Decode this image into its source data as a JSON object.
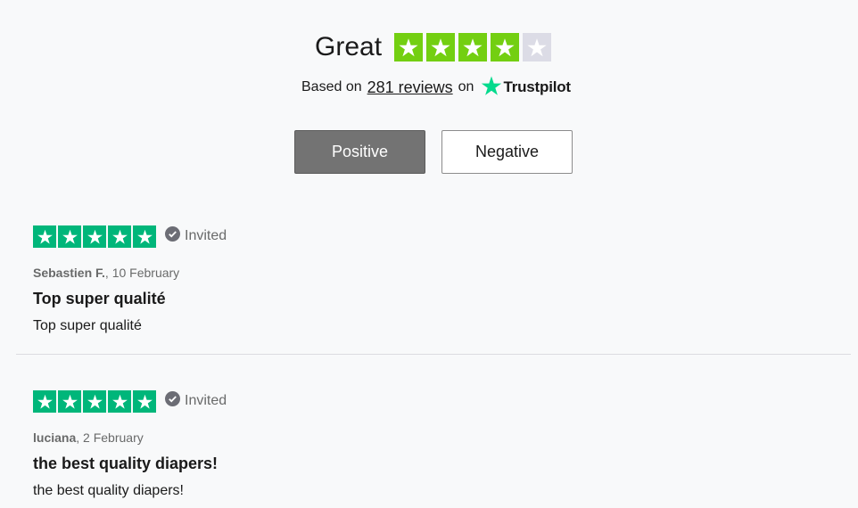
{
  "summary": {
    "rating_word": "Great",
    "rating_stars": 4,
    "rating_max": 5,
    "based_on_prefix": "Based on",
    "reviews_link": "281 reviews",
    "on_word": "on",
    "brand": "Trustpilot"
  },
  "filters": {
    "positive_label": "Positive",
    "negative_label": "Negative",
    "active": "positive"
  },
  "reviews": [
    {
      "stars": 5,
      "badge": "Invited",
      "author": "Sebastien F.",
      "date": "10 February",
      "title": "Top super qualité",
      "body": "Top super qualité"
    },
    {
      "stars": 5,
      "badge": "Invited",
      "author": "luciana",
      "date": "2 February",
      "title": "the best quality diapers!",
      "body": "the best quality diapers!"
    }
  ],
  "colors": {
    "star_green_summary": "#73cf11",
    "star_empty": "#dcdce6",
    "star_green_review": "#00b67a",
    "trustpilot_star": "#04da8d",
    "positive_bg": "#737373"
  }
}
